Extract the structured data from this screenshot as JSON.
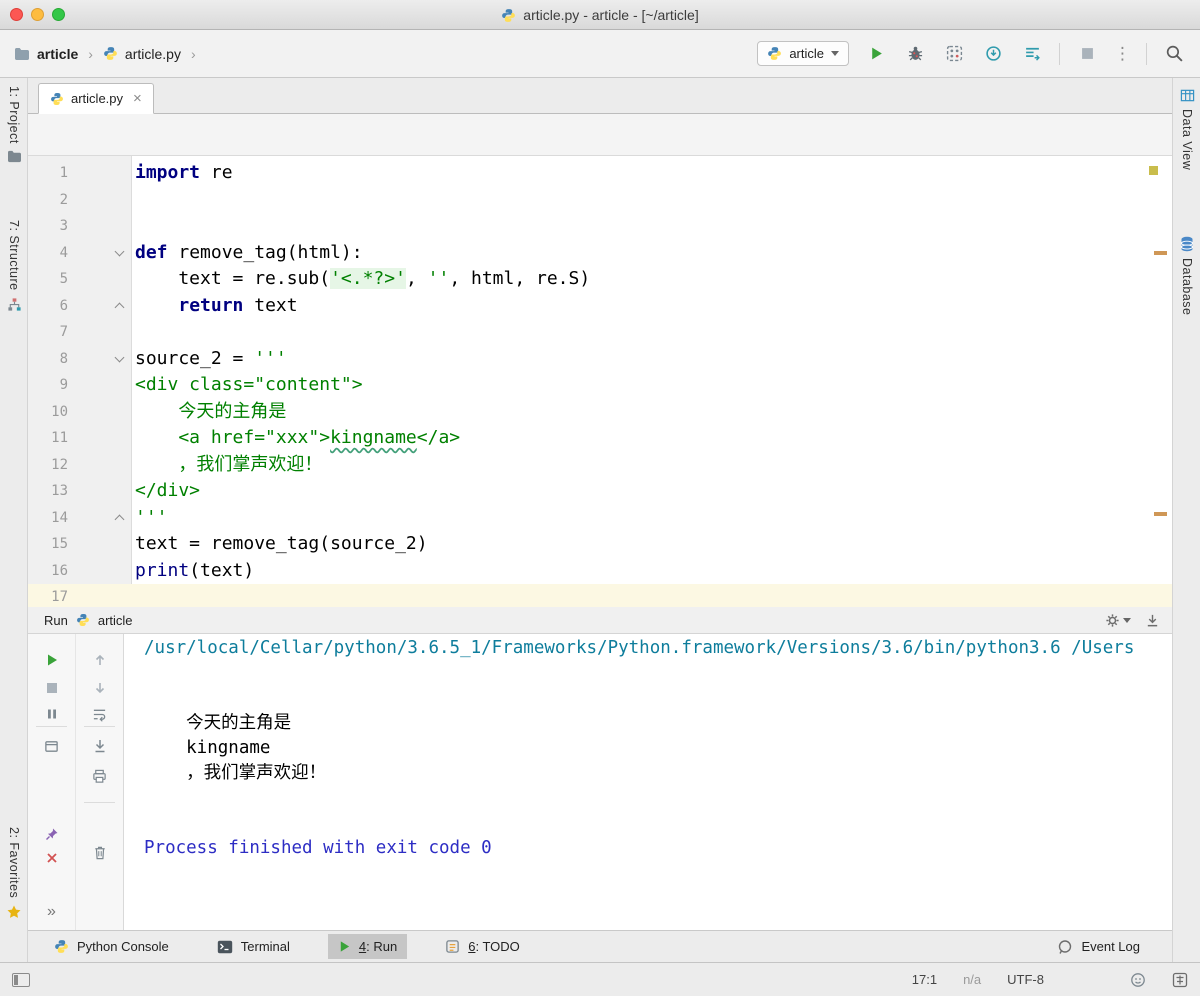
{
  "colors": {
    "kw": "#000080",
    "builtin": "#000080",
    "str": "#008000",
    "str-bg": "#e6f6e6",
    "lineno": "#9b9b9b",
    "current-line": "#fcf8e3",
    "run-green": "#3aa33a",
    "console-sys": "#0e7d9c",
    "console-info": "#2d2dc4",
    "python-blue": "#4584b6",
    "python-yellow": "#ffde57"
  },
  "icons": {
    "close_tab": "×",
    "breadcrumb_sep": "›",
    "kebab": "⋮",
    "more_chevrons": "»"
  },
  "window": {
    "title": "article.py - article - [~/article]"
  },
  "navbar": {
    "breadcrumbs": [
      {
        "label": "article"
      },
      {
        "label": "article.py"
      }
    ],
    "run_config": {
      "label": "article"
    }
  },
  "tabs": [
    {
      "label": "article.py"
    }
  ],
  "tool_stripes": {
    "left": [
      {
        "label": "1: Project"
      },
      {
        "label": "7: Structure"
      },
      {
        "label": "2: Favorites"
      }
    ],
    "right": [
      {
        "label": "Data View"
      },
      {
        "label": "Database"
      }
    ]
  },
  "editor": {
    "lines": [
      {
        "num": "1",
        "segments": [
          {
            "t": "import",
            "c": "kw"
          },
          {
            "t": " re",
            "c": ""
          }
        ]
      },
      {
        "num": "2",
        "segments": []
      },
      {
        "num": "3",
        "segments": []
      },
      {
        "num": "4",
        "fold": "open",
        "segments": [
          {
            "t": "def",
            "c": "kw"
          },
          {
            "t": " remove_tag(html):",
            "c": ""
          }
        ]
      },
      {
        "num": "5",
        "segments": [
          {
            "t": "    text = re.sub(",
            "c": ""
          },
          {
            "t": "'<.*?>'",
            "c": "strh"
          },
          {
            "t": ", ",
            "c": ""
          },
          {
            "t": "''",
            "c": "str"
          },
          {
            "t": ", html, re.S)",
            "c": ""
          }
        ]
      },
      {
        "num": "6",
        "fold": "end",
        "segments": [
          {
            "t": "    ",
            "c": ""
          },
          {
            "t": "return",
            "c": "kw"
          },
          {
            "t": " text",
            "c": ""
          }
        ]
      },
      {
        "num": "7",
        "segments": []
      },
      {
        "num": "8",
        "fold": "open",
        "segments": [
          {
            "t": "source_2 = ",
            "c": ""
          },
          {
            "t": "'''",
            "c": "str"
          }
        ]
      },
      {
        "num": "9",
        "segments": [
          {
            "t": "<div class=\"content\">",
            "c": "str"
          }
        ]
      },
      {
        "num": "10",
        "segments": [
          {
            "t": "    今天的主角是",
            "c": "str"
          }
        ]
      },
      {
        "num": "11",
        "segments": [
          {
            "t": "    <a href=\"xxx\">",
            "c": "str"
          },
          {
            "t": "kingname",
            "c": "str wavy"
          },
          {
            "t": "</a>",
            "c": "str"
          }
        ]
      },
      {
        "num": "12",
        "segments": [
          {
            "t": "    ，我们掌声欢迎！",
            "c": "str"
          }
        ]
      },
      {
        "num": "13",
        "segments": [
          {
            "t": "</div>",
            "c": "str"
          }
        ]
      },
      {
        "num": "14",
        "fold": "end",
        "segments": [
          {
            "t": "'''",
            "c": "str"
          }
        ]
      },
      {
        "num": "15",
        "segments": [
          {
            "t": "text = remove_tag(source_2)",
            "c": ""
          }
        ]
      },
      {
        "num": "16",
        "segments": [
          {
            "t": "print",
            "c": "b"
          },
          {
            "t": "(text)",
            "c": ""
          }
        ]
      },
      {
        "num": "17",
        "current": true,
        "segments": []
      }
    ]
  },
  "run_panel": {
    "title": "Run",
    "config": "article",
    "console_lines": [
      {
        "t": "/usr/local/Cellar/python/3.6.5_1/Frameworks/Python.framework/Versions/3.6/bin/python3.6 /Users",
        "c": "sys"
      },
      {
        "t": "",
        "c": ""
      },
      {
        "t": "",
        "c": ""
      },
      {
        "t": "    今天的主角是",
        "c": ""
      },
      {
        "t": "    kingname",
        "c": ""
      },
      {
        "t": "    ，我们掌声欢迎！",
        "c": ""
      },
      {
        "t": "",
        "c": ""
      },
      {
        "t": "",
        "c": ""
      },
      {
        "t": "Process finished with exit code 0",
        "c": "info"
      }
    ]
  },
  "bottom_bar": {
    "items": [
      {
        "mnemonic": "",
        "label": "Python Console"
      },
      {
        "mnemonic": "",
        "label": "Terminal"
      },
      {
        "mnemonic": "4",
        "label": ": Run"
      },
      {
        "mnemonic": "6",
        "label": ": TODO"
      }
    ],
    "event_log": "Event Log"
  },
  "status_bar": {
    "caret": "17:1",
    "line_sep": "n/a",
    "encoding": "UTF-8"
  }
}
